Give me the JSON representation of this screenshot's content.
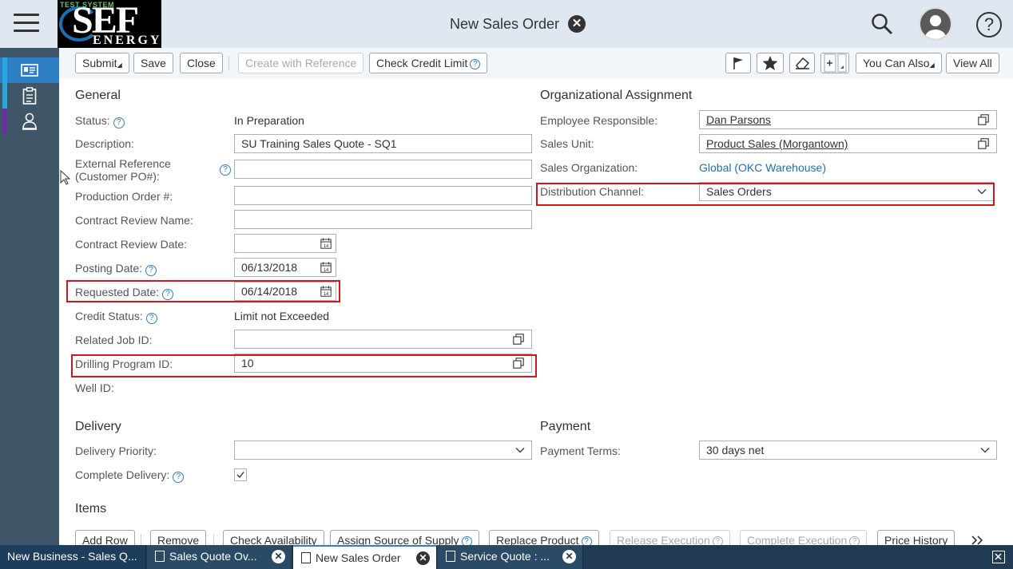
{
  "header": {
    "logo_test_text": "TEST SYSTEM",
    "logo_main_text": "SEF",
    "logo_sub_text": "ENERGY",
    "title": "New Sales Order"
  },
  "toolbar": {
    "submit": "Submit",
    "save": "Save",
    "close": "Close",
    "create_with_reference": "Create with Reference",
    "check_credit_limit": "Check Credit Limit",
    "you_can_also": "You Can Also",
    "view_all": "View All"
  },
  "general": {
    "title": "General",
    "status_label": "Status:",
    "status_value": "In Preparation",
    "description_label": "Description:",
    "description_value": "SU Training Sales Quote - SQ1",
    "external_ref_label_1": "External Reference",
    "external_ref_label_2": "(Customer PO#):",
    "production_order_label": "Production Order #:",
    "contract_review_name_label": "Contract Review Name:",
    "contract_review_date_label": "Contract Review Date:",
    "posting_date_label": "Posting Date:",
    "posting_date_value": "06/13/2018",
    "requested_date_label": "Requested Date:",
    "requested_date_value": "06/14/2018",
    "credit_status_label": "Credit Status:",
    "credit_status_value": "Limit not Exceeded",
    "related_job_label": "Related Job ID:",
    "drilling_program_label": "Drilling Program ID:",
    "drilling_program_value": "10",
    "well_id_label": "Well ID:"
  },
  "org": {
    "title": "Organizational Assignment",
    "employee_label": "Employee Responsible:",
    "employee_value": "Dan Parsons",
    "sales_unit_label": "Sales Unit:",
    "sales_unit_value": "Product Sales (Morgantown)",
    "sales_org_label": "Sales Organization:",
    "sales_org_value": "Global (OKC Warehouse)",
    "distribution_label": "Distribution Channel:",
    "distribution_value": "Sales Orders"
  },
  "delivery": {
    "title": "Delivery",
    "priority_label": "Delivery Priority:",
    "complete_label": "Complete Delivery:"
  },
  "payment": {
    "title": "Payment",
    "terms_label": "Payment Terms:",
    "terms_value": "30 days net"
  },
  "items": {
    "title": "Items",
    "add_row": "Add Row",
    "remove": "Remove",
    "check_availability": "Check Availability",
    "assign_source": "Assign Source of Supply",
    "replace_product": "Replace Product",
    "release_execution": "Release Execution",
    "complete_execution": "Complete Execution",
    "price_history": "Price History"
  },
  "tabs": [
    {
      "label": "New Business - Sales Q..."
    },
    {
      "label": "Sales Quote Ov..."
    },
    {
      "label": "New Sales Order"
    },
    {
      "label": "Service Quote : ..."
    }
  ],
  "colors": {
    "accent": "#2e7fc4",
    "highlight": "#d6141c",
    "rail": "#3f5568",
    "taskbar": "#1f3a52"
  }
}
